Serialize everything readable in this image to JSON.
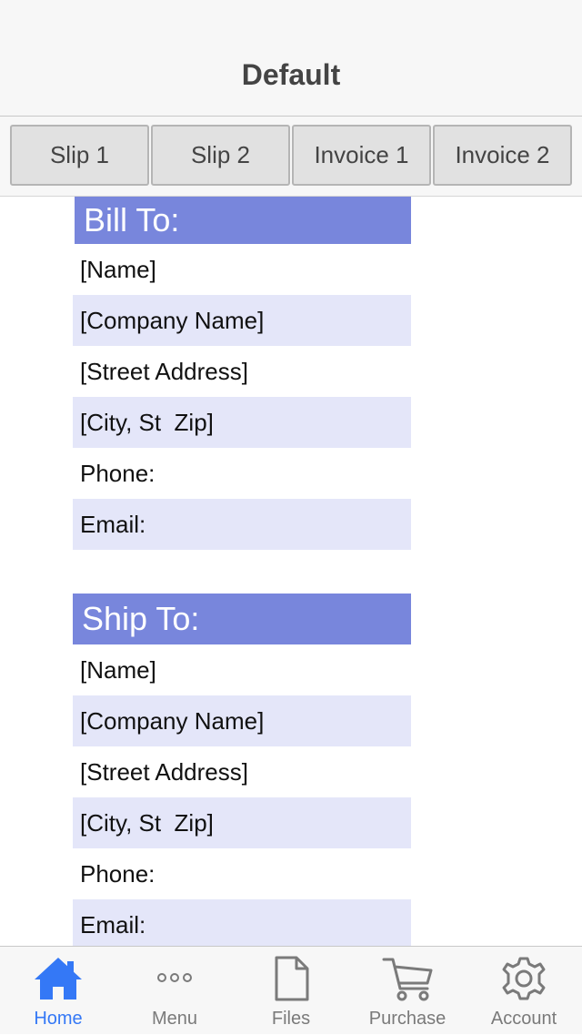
{
  "nav": {
    "title": "Default"
  },
  "segments": [
    "Slip 1",
    "Slip 2",
    "Invoice 1",
    "Invoice 2"
  ],
  "bill_to": {
    "header": "Bill To:",
    "name": "[Name]",
    "company": "[Company Name]",
    "street": "[Street Address]",
    "city": "[City, St  Zip]",
    "phone": "Phone:",
    "email": "Email:"
  },
  "ship_to": {
    "header": "Ship To:",
    "name": "[Name]",
    "company": "[Company Name]",
    "street": "[Street Address]",
    "city": "[City, St  Zip]",
    "phone": "Phone:",
    "email": "Email:"
  },
  "tabs": [
    {
      "label": "Home",
      "icon": "home-icon",
      "active": true
    },
    {
      "label": "Menu",
      "icon": "more-dots-icon",
      "active": false
    },
    {
      "label": "Files",
      "icon": "file-icon",
      "active": false
    },
    {
      "label": "Purchase",
      "icon": "cart-icon",
      "active": false
    },
    {
      "label": "Account",
      "icon": "gear-icon",
      "active": false
    }
  ],
  "colors": {
    "header_fill": "#7886dc",
    "alt_row_fill": "#e4e6f9",
    "active_tab": "#3478f6",
    "inactive_tab": "#7a7a7a"
  }
}
